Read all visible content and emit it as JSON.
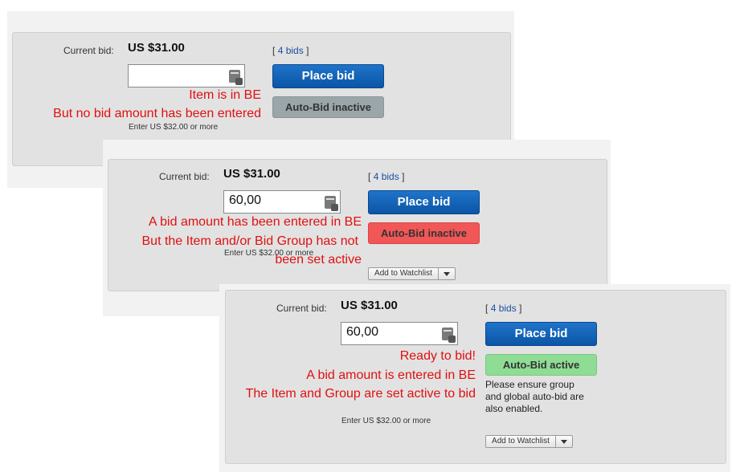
{
  "panel1": {
    "current_bid_label": "Current bid:",
    "price": "US $31.00",
    "bids_open": "[",
    "bids_link": "4 bids",
    "bids_close": "]",
    "bid_input_value": "",
    "place_bid_label": "Place bid",
    "auto_bid_label": "Auto-Bid inactive",
    "hint": "Enter US $32.00 or more",
    "annotation_line1": "Item is in BE",
    "annotation_line2": "But no bid amount has been entered"
  },
  "panel2": {
    "current_bid_label": "Current bid:",
    "price": "US $31.00",
    "bids_open": "[",
    "bids_link": "4 bids",
    "bids_close": "]",
    "bid_input_value": "60,00",
    "place_bid_label": "Place bid",
    "auto_bid_label": "Auto-Bid inactive",
    "hint": "Enter US $32.00 or more",
    "watchlist_label": "Add to Watchlist",
    "annotation_line1": "A bid amount has been entered in BE",
    "annotation_line2": "But the Item and/or Bid Group has not",
    "annotation_line3": "been set active"
  },
  "panel3": {
    "current_bid_label": "Current bid:",
    "price": "US $31.00",
    "bids_open": "[",
    "bids_link": "4 bids",
    "bids_close": "]",
    "bid_input_value": "60,00",
    "place_bid_label": "Place bid",
    "auto_bid_label": "Auto-Bid active",
    "note_line1": "Please ensure group",
    "note_line2": "and global auto-bid are",
    "note_line3": "also enabled.",
    "hint": "Enter US $32.00 or more",
    "watchlist_label": "Add to Watchlist",
    "annotation_line1": "Ready to bid!",
    "annotation_line2": "A bid amount is entered in BE",
    "annotation_line3": "The Item and Group are set active to bid"
  },
  "colors": {
    "place_bid": "#0b55a6",
    "auto_inactive_grey": "#9aa6aa",
    "auto_inactive_red": "#f25757",
    "auto_active_green": "#8fdc95",
    "annotation_red": "#e01010",
    "link_blue": "#1a4fa0"
  },
  "icons": {
    "calculator": "calculator-icon",
    "dropdown": "chevron-down-icon"
  }
}
